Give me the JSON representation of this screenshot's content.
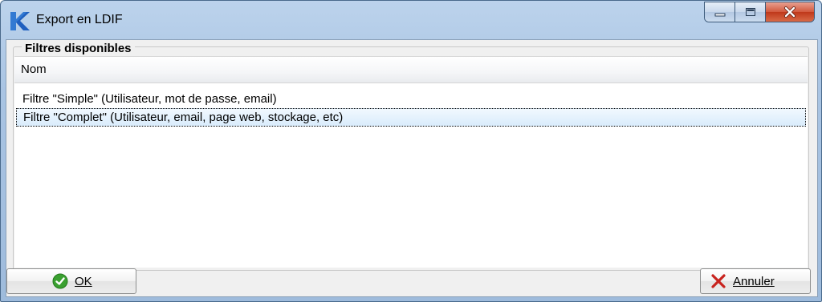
{
  "window": {
    "title": "Export en LDIF"
  },
  "group": {
    "legend": "Filtres disponibles"
  },
  "list": {
    "column_header": "Nom",
    "rows": [
      "Filtre \"Simple\" (Utilisateur, mot de passe, email)",
      "Filtre \"Complet\" (Utilisateur, email, page web, stockage, etc)"
    ],
    "selected_index": 1
  },
  "buttons": {
    "ok_label": "OK",
    "cancel_label": "Annuler"
  },
  "icons": {
    "app": "k-logo-icon",
    "ok": "check-circle-icon",
    "cancel": "x-icon"
  },
  "colors": {
    "accent": "#1f5fbf",
    "ok_green": "#3aa030",
    "cancel_red": "#c8231e",
    "selection": "#d9ecfc"
  }
}
